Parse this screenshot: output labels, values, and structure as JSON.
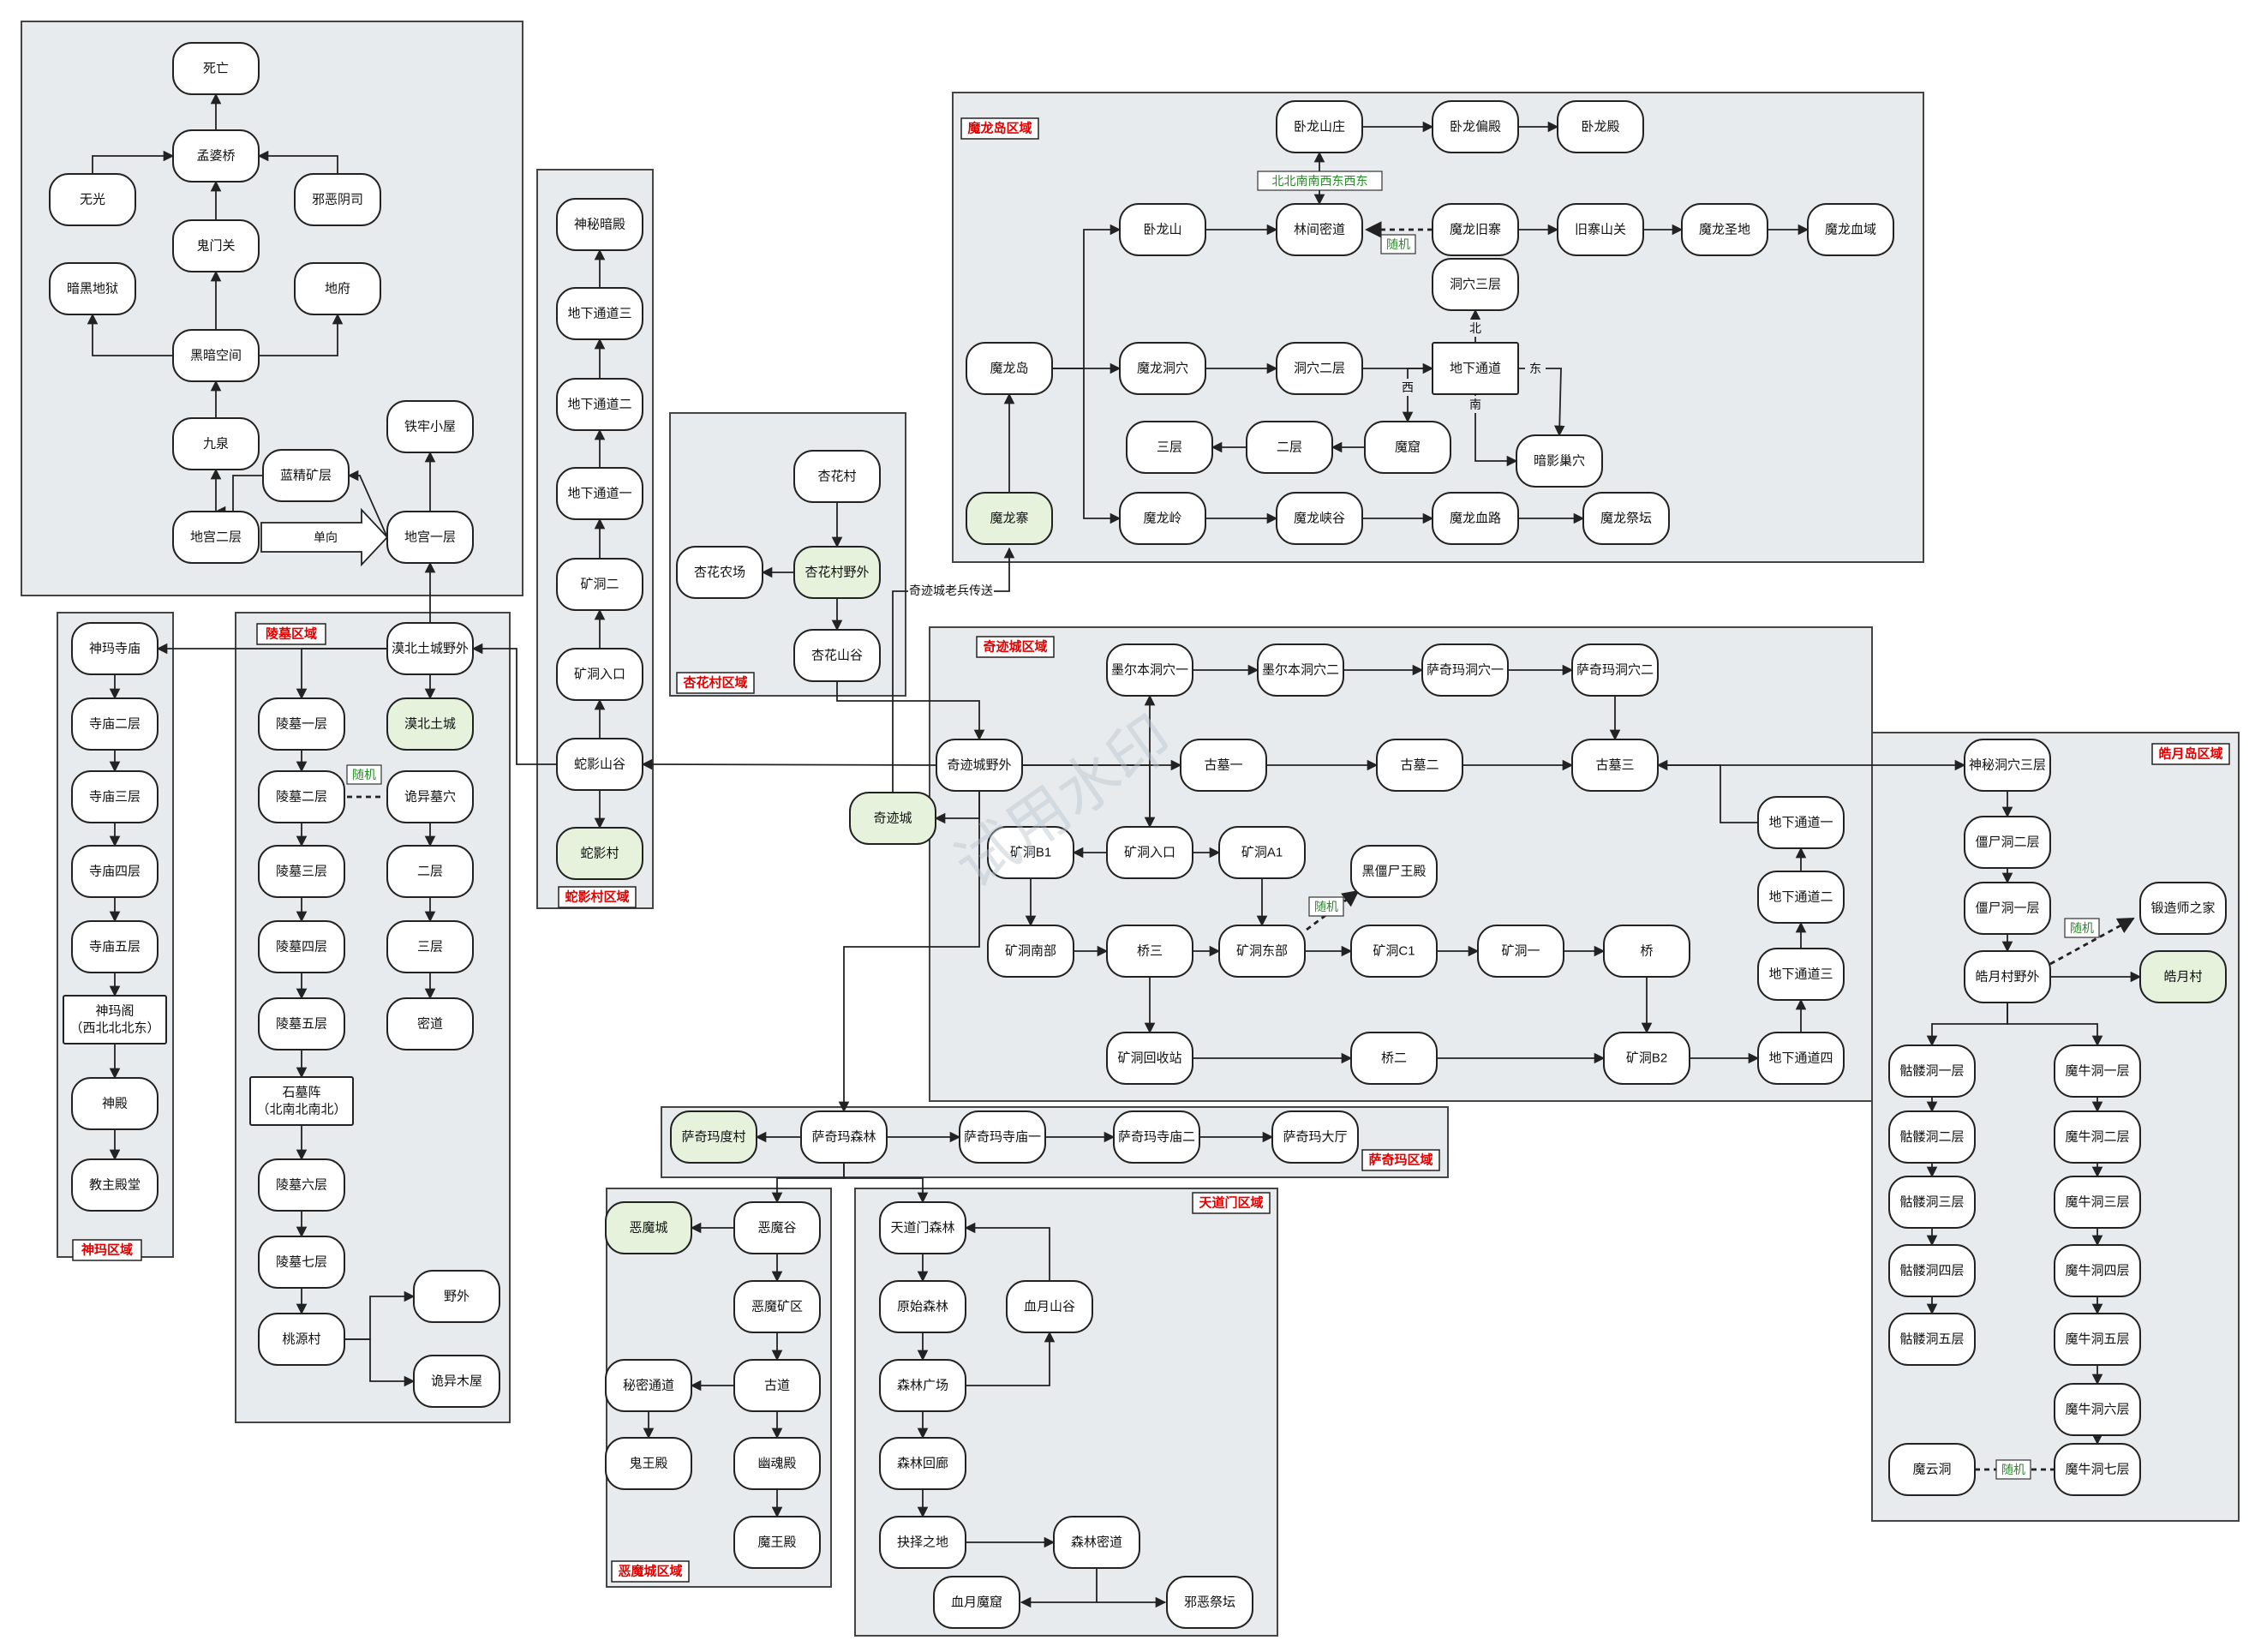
{
  "regions": [
    {
      "id": "top",
      "label": ""
    },
    {
      "id": "lingmu",
      "label": "陵墓区域"
    },
    {
      "id": "shenma",
      "label": "神玛区域"
    },
    {
      "id": "sheying",
      "label": "蛇影村区域"
    },
    {
      "id": "xinghua",
      "label": "杏花村区域"
    },
    {
      "id": "molong",
      "label": "魔龙岛区域"
    },
    {
      "id": "qiji",
      "label": "奇迹城区域"
    },
    {
      "id": "saqima",
      "label": "萨奇玛区域"
    },
    {
      "id": "emo",
      "label": "恶魔城区域"
    },
    {
      "id": "tiandao",
      "label": "天道门区域"
    },
    {
      "id": "haoyue",
      "label": "皓月岛区域"
    }
  ],
  "nodes": {
    "siwang": "死亡",
    "mengpo": "孟婆桥",
    "wuguang": "无光",
    "xiee": "邪恶阴司",
    "guimen": "鬼门关",
    "anhei": "暗黑地狱",
    "difu": "地府",
    "heian": "黑暗空间",
    "jiuquan": "九泉",
    "tielao": "铁牢小屋",
    "lanjing": "蓝精矿层",
    "digong2": "地宫二层",
    "digong1": "地宫一层",
    "shenmi": "神秘暗殿",
    "dx3": "地下通道三",
    "dx2": "地下通道二",
    "dx1": "地下通道一",
    "kd2": "矿洞二",
    "kdrk": "矿洞入口",
    "sheyingshangu": "蛇影山谷",
    "sheyingcun": "蛇影村",
    "xinghuacun": "杏花村",
    "xinghuanongchang": "杏花农场",
    "xinghuaye": "杏花村野外",
    "xinghuashangu": "杏花山谷",
    "wolongshanzhuang": "卧龙山庄",
    "wolongpiandian": "卧龙偏殿",
    "wolongdian": "卧龙殿",
    "wolongshan": "卧龙山",
    "linjian": "林间密道",
    "molongjiu": "魔龙旧寨",
    "jiuzhai": "旧寨山关",
    "molongshengdi": "魔龙圣地",
    "molongxueyu": "魔龙血域",
    "dongxue3": "洞穴三层",
    "molongdao": "魔龙岛",
    "molongdongxue": "魔龙洞穴",
    "dongxue2": "洞穴二层",
    "dixiatongdao": "地下通道",
    "sanceng": "三层",
    "erceng": "二层",
    "moku": "魔窟",
    "anying": "暗影巢穴",
    "molongzhai": "魔龙寨",
    "molongling": "魔龙岭",
    "molongxiagu": "魔龙峡谷",
    "molongxuelu": "魔龙血路",
    "molongjitan": "魔龙祭坛",
    "moer1": "墨尔本洞穴一",
    "moer2": "墨尔本洞穴二",
    "saqi1": "萨奇玛洞穴一",
    "saqi2": "萨奇玛洞穴二",
    "qijiye": "奇迹城野外",
    "gumu1": "古墓一",
    "gumu2": "古墓二",
    "gumu3": "古墓三",
    "qijicheng": "奇迹城",
    "kdb1": "矿洞B1",
    "qjkdrk": "矿洞入口",
    "kda1": "矿洞A1",
    "heijiangshi": "黑僵尸王殿",
    "qjdx1": "地下通道一",
    "qjdx2": "地下通道二",
    "qjdx3": "地下通道三",
    "qjdx4": "地下通道四",
    "kdnan": "矿洞南部",
    "qiao3": "桥三",
    "kddong": "矿洞东部",
    "kdc1": "矿洞C1",
    "kuangdong1": "矿洞一",
    "qiao": "桥",
    "kdhuishou": "矿洞回收站",
    "qiao2": "桥二",
    "kdb2": "矿洞B2",
    "mobei": "漠北土城野外",
    "mobeicheng": "漠北土城",
    "lm1": "陵墓一层",
    "lm2": "陵墓二层",
    "guiyi": "诡异墓穴",
    "lm3": "陵墓三层",
    "lmer": "二层",
    "lm4": "陵墓四层",
    "lmsan": "三层",
    "lm5": "陵墓五层",
    "miku": "密道",
    "shimu1": "石墓阵",
    "shimu2": "（北南北南北）",
    "lm6": "陵墓六层",
    "lm7": "陵墓七层",
    "taoyuan": "桃源村",
    "yewai": "野外",
    "guiyimuwu": "诡异木屋",
    "shenmasi": "神玛寺庙",
    "sm2": "寺庙二层",
    "sm3": "寺庙三层",
    "sm4": "寺庙四层",
    "sm5": "寺庙五层",
    "shenmage1": "神玛阁",
    "shenmage2": "（西北北北东）",
    "shendian": "神殿",
    "jiaozhu": "教主殿堂",
    "saqimadu": "萨奇玛度村",
    "saqimasl": "萨奇玛森林",
    "saqimasm1": "萨奇玛寺庙一",
    "saqimasm2": "萨奇玛寺庙二",
    "saqimadt": "萨奇玛大厅",
    "emocheng": "恶魔城",
    "emogu": "恶魔谷",
    "emokuang": "恶魔矿区",
    "mimi": "秘密通道",
    "gudao": "古道",
    "guiwang": "鬼王殿",
    "youhun": "幽魂殿",
    "mowang": "魔王殿",
    "tiandaomen": "天道门森林",
    "yuanshi": "原始森林",
    "xueyue": "血月山谷",
    "senlinguang": "森林广场",
    "senlinhui": "森林回廊",
    "jueze": "抉择之地",
    "senlinmi": "森林密道",
    "xueyuemo": "血月魔窟",
    "xieejitan": "邪恶祭坛",
    "shenmi3": "神秘洞穴三层",
    "jiangshi2": "僵尸洞二层",
    "jiangshi1": "僵尸洞一层",
    "duanzao": "锻造师之家",
    "haoyueye": "皓月村野外",
    "haoyuecun": "皓月村",
    "kl1": "骷髅洞一层",
    "kl2": "骷髅洞二层",
    "kl3": "骷髅洞三层",
    "kl4": "骷髅洞四层",
    "kl5": "骷髅洞五层",
    "mn1": "魔牛洞一层",
    "mn2": "魔牛洞二层",
    "mn3": "魔牛洞三层",
    "mn4": "魔牛洞四层",
    "mn5": "魔牛洞五层",
    "mn6": "魔牛洞六层",
    "mn7": "魔牛洞七层",
    "moyun": "魔云洞"
  },
  "edge_labels": {
    "random": "随机",
    "oneway": "单向",
    "wolong_dir": "北北南南西东西东",
    "north": "北",
    "west": "西",
    "east": "东",
    "south": "南",
    "chuansong": "奇迹城老兵传送"
  },
  "watermark": "试用水印"
}
